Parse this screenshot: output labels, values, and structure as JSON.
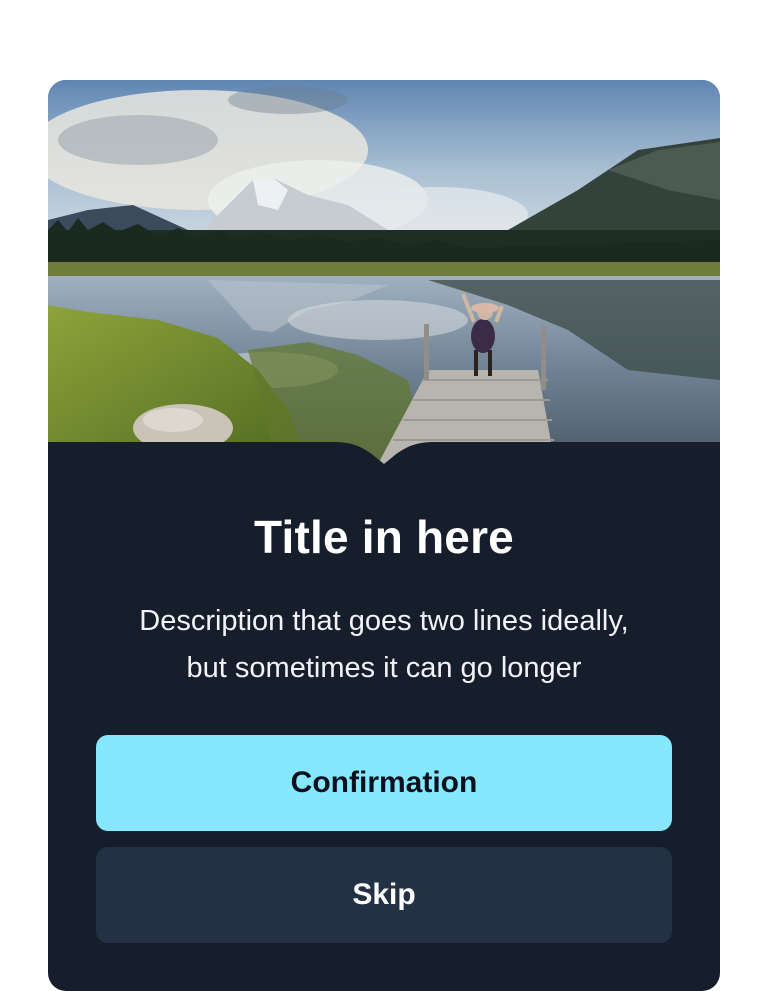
{
  "card": {
    "image_alt": "Person standing on a wooden dock at a mountain lake",
    "title": "Title in here",
    "description_line1": "Description that goes two lines ideally,",
    "description_line2": "but sometimes it can go longer",
    "confirm_label": "Confirmation",
    "skip_label": "Skip"
  },
  "colors": {
    "page_background": "#ffffff",
    "card_background": "#161d2b",
    "confirm_button": "#85e8ff",
    "skip_button": "#243145",
    "title_text": "#ffffff"
  }
}
